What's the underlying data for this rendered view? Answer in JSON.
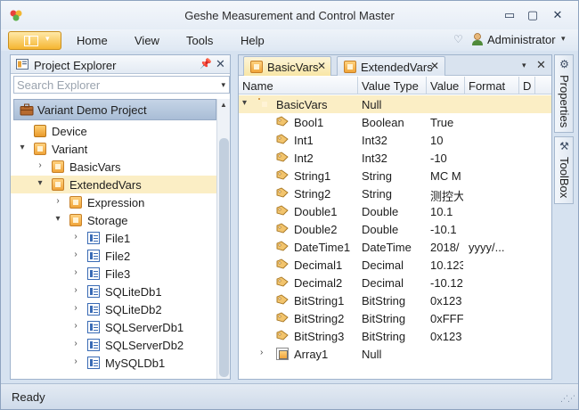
{
  "window": {
    "title": "Geshe Measurement and Control Master",
    "controls": {
      "minimize": "▭",
      "maximize": "▢",
      "close": "✕"
    }
  },
  "menu": {
    "items": [
      "Home",
      "View",
      "Tools",
      "Help"
    ],
    "user": "Administrator"
  },
  "explorer": {
    "title": "Project Explorer",
    "search_placeholder": "Search Explorer",
    "project": "Variant Demo Project",
    "tree": [
      {
        "label": "Device",
        "level": 0,
        "expander": "",
        "icon": "device-icon"
      },
      {
        "label": "Variant",
        "level": 0,
        "expander": "▾",
        "icon": "folder-icon"
      },
      {
        "label": "BasicVars",
        "level": 1,
        "expander": "›",
        "icon": "folder-icon"
      },
      {
        "label": "ExtendedVars",
        "level": 1,
        "expander": "▾",
        "icon": "folder-icon",
        "selected": true
      },
      {
        "label": "Expression",
        "level": 2,
        "expander": "›",
        "icon": "folder-icon"
      },
      {
        "label": "Storage",
        "level": 2,
        "expander": "▾",
        "icon": "folder-icon"
      },
      {
        "label": "File1",
        "level": 3,
        "expander": "›",
        "icon": "db-icon"
      },
      {
        "label": "File2",
        "level": 3,
        "expander": "›",
        "icon": "db-icon"
      },
      {
        "label": "File3",
        "level": 3,
        "expander": "›",
        "icon": "db-icon"
      },
      {
        "label": "SQLiteDb1",
        "level": 3,
        "expander": "›",
        "icon": "db-icon"
      },
      {
        "label": "SQLiteDb2",
        "level": 3,
        "expander": "›",
        "icon": "db-icon"
      },
      {
        "label": "SQLServerDb1",
        "level": 3,
        "expander": "›",
        "icon": "db-icon"
      },
      {
        "label": "SQLServerDb2",
        "level": 3,
        "expander": "›",
        "icon": "db-icon"
      },
      {
        "label": "MySQLDb1",
        "level": 3,
        "expander": "›",
        "icon": "db-icon"
      }
    ]
  },
  "tabs": [
    {
      "label": "BasicVars",
      "active": true
    },
    {
      "label": "ExtendedVars",
      "active": false
    }
  ],
  "grid": {
    "columns": [
      "Name",
      "Value Type",
      "Value",
      "Format",
      "D"
    ],
    "rows": [
      {
        "name": "BasicVars",
        "type": "Null",
        "value": "",
        "format": "",
        "level": 0,
        "expander": "▾",
        "icon": "folder-icon",
        "selected": true
      },
      {
        "name": "Bool1",
        "type": "Boolean",
        "value": "True",
        "format": "",
        "level": 1,
        "expander": "",
        "icon": "tag-icon"
      },
      {
        "name": "Int1",
        "type": "Int32",
        "value": "10",
        "format": "",
        "level": 1,
        "expander": "",
        "icon": "tag-icon"
      },
      {
        "name": "Int2",
        "type": "Int32",
        "value": "-10",
        "format": "",
        "level": 1,
        "expander": "",
        "icon": "tag-icon"
      },
      {
        "name": "String1",
        "type": "String",
        "value": "MC M",
        "format": "",
        "level": 1,
        "expander": "",
        "icon": "tag-icon"
      },
      {
        "name": "String2",
        "type": "String",
        "value": "测控大",
        "format": "",
        "level": 1,
        "expander": "",
        "icon": "tag-icon"
      },
      {
        "name": "Double1",
        "type": "Double",
        "value": "10.1",
        "format": "",
        "level": 1,
        "expander": "",
        "icon": "tag-icon"
      },
      {
        "name": "Double2",
        "type": "Double",
        "value": "-10.1",
        "format": "",
        "level": 1,
        "expander": "",
        "icon": "tag-icon"
      },
      {
        "name": "DateTime1",
        "type": "DateTime",
        "value": "2018/",
        "format": "yyyy/...",
        "level": 1,
        "expander": "",
        "icon": "tag-icon"
      },
      {
        "name": "Decimal1",
        "type": "Decimal",
        "value": "10.123",
        "format": "",
        "level": 1,
        "expander": "",
        "icon": "tag-icon"
      },
      {
        "name": "Decimal2",
        "type": "Decimal",
        "value": "-10.12",
        "format": "",
        "level": 1,
        "expander": "",
        "icon": "tag-icon"
      },
      {
        "name": "BitString1",
        "type": "BitString",
        "value": "0x123",
        "format": "",
        "level": 1,
        "expander": "",
        "icon": "tag-icon"
      },
      {
        "name": "BitString2",
        "type": "BitString",
        "value": "0xFFF",
        "format": "",
        "level": 1,
        "expander": "",
        "icon": "tag-icon"
      },
      {
        "name": "BitString3",
        "type": "BitString",
        "value": "0x123",
        "format": "",
        "level": 1,
        "expander": "",
        "icon": "tag-icon"
      },
      {
        "name": "Array1",
        "type": "Null",
        "value": "",
        "format": "",
        "level": 1,
        "expander": "›",
        "icon": "array-icon"
      }
    ]
  },
  "side_tabs": [
    "Properties",
    "ToolBox"
  ],
  "status": "Ready",
  "colors": {
    "accent": "#f5b531",
    "selection": "#fbeec5",
    "frame": "#d6e2f0"
  }
}
